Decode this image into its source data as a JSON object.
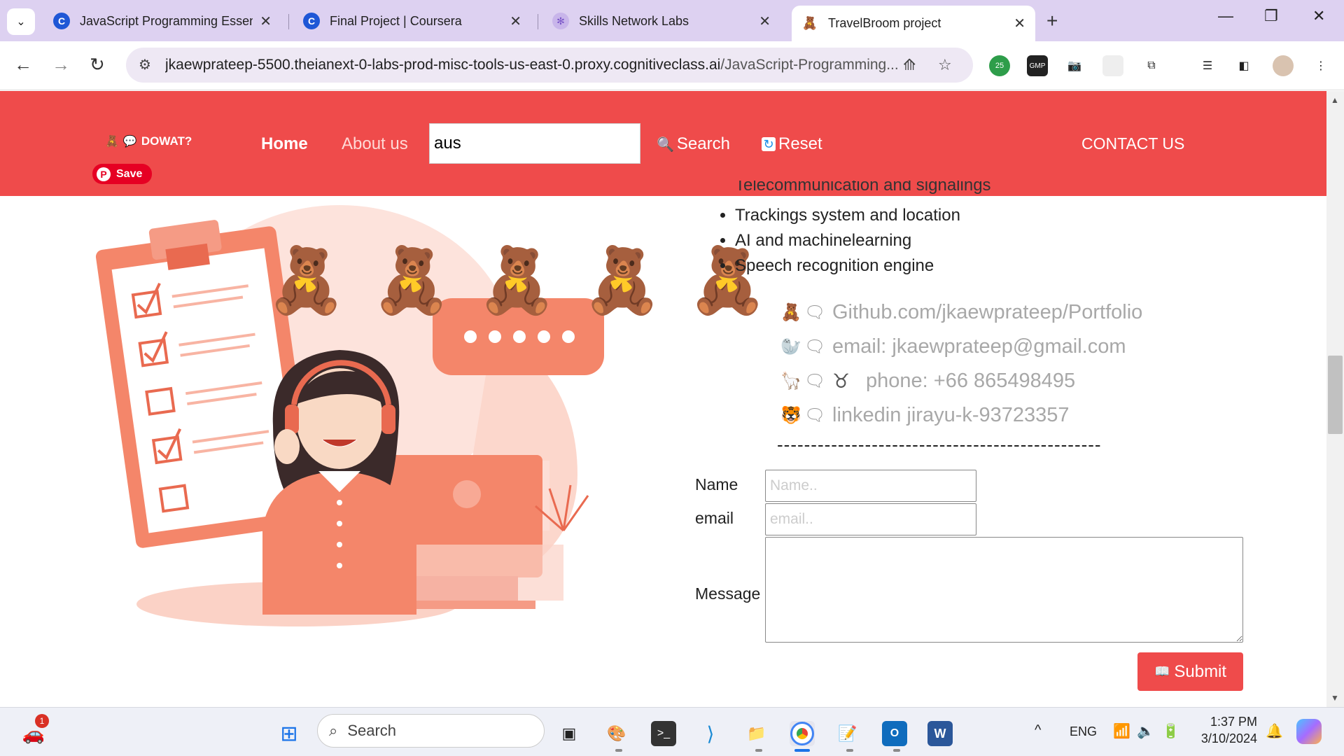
{
  "browser": {
    "tabs": [
      {
        "title": "JavaScript Programming Essenti",
        "favicon": "coursera-icon",
        "active": false
      },
      {
        "title": "Final Project | Coursera",
        "favicon": "coursera-icon",
        "active": false
      },
      {
        "title": "Skills Network Labs",
        "favicon": "skills-network-icon",
        "active": false
      },
      {
        "title": "TravelBroom project",
        "favicon": "teddy-bear-icon",
        "active": true
      }
    ],
    "url_host": "jkaewprateep-5500.theianext-0-labs-prod-misc-tools-us-east-0.proxy.cognitiveclass.ai",
    "url_path": "/JavaScript-Programming...",
    "extension_badge": "25"
  },
  "header": {
    "brand": "DOWAT?",
    "save_label": "Save",
    "nav_home": "Home",
    "nav_about": "About us",
    "search_value": "aus",
    "search_button": "Search",
    "reset_button": "Reset",
    "contact_link": "CONTACT US"
  },
  "content": {
    "clipped_item": "Telecommunication and signalings",
    "features": [
      "Trackings system and location",
      "AI and machinelearning",
      "Speech recognition engine"
    ],
    "contacts": [
      {
        "emoji": "🧸",
        "text": "Github.com/jkaewprateep/Portfolio"
      },
      {
        "emoji": "🦭",
        "text": "email: jkaewprateep@gmail.com"
      },
      {
        "emoji": "🦙",
        "symbol": "♉",
        "text": "phone: +66 865498495"
      },
      {
        "emoji": "🐯",
        "text": "linkedin jirayu-k-93723357"
      }
    ],
    "divider": "------------------------------------------------"
  },
  "form": {
    "name_label": "Name",
    "name_placeholder": "Name..",
    "email_label": "email",
    "email_placeholder": "email..",
    "message_label": "Message",
    "submit_label": "Submit"
  },
  "taskbar": {
    "search_placeholder": "Search",
    "language": "ENG",
    "time": "1:37 PM",
    "date": "3/10/2024",
    "notification_count": "1"
  },
  "colors": {
    "accent": "#ef4b4b",
    "tab_strip": "#ddd1f1",
    "illustration": "#f4866a"
  }
}
